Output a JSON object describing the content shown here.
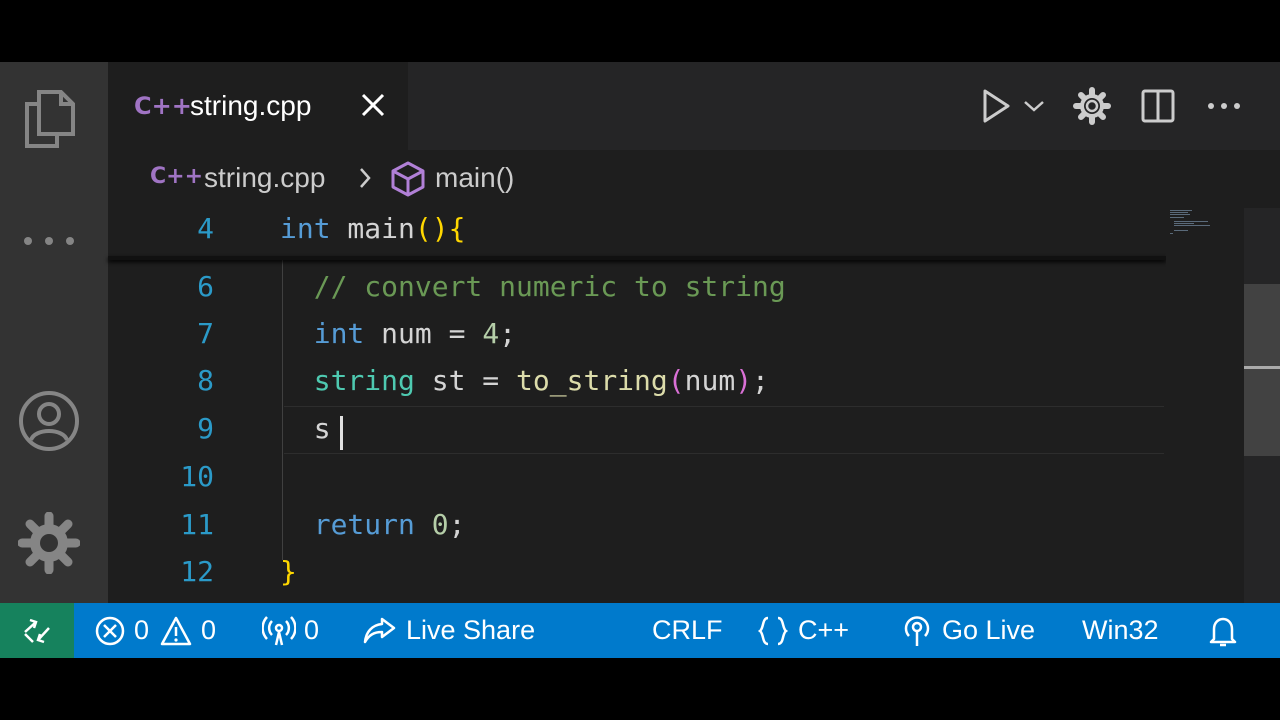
{
  "tab": {
    "lang_badge": "C++",
    "filename": "string.cpp"
  },
  "breadcrumb": {
    "lang_badge": "C++",
    "file": "string.cpp",
    "symbol": "main()"
  },
  "editor": {
    "sticky_line": {
      "number": "4",
      "tokens": [
        [
          "int",
          "kw"
        ],
        [
          " main",
          ""
        ],
        [
          "()",
          "br1"
        ],
        [
          "{",
          "br1"
        ]
      ]
    },
    "lines": [
      {
        "number": "6",
        "tokens": [
          [
            "  // convert numeric to string",
            "cm"
          ]
        ]
      },
      {
        "number": "7",
        "tokens": [
          [
            "  ",
            ""
          ],
          [
            "int",
            "kw"
          ],
          [
            " num = ",
            ""
          ],
          [
            "4",
            "nm"
          ],
          [
            ";",
            ""
          ]
        ]
      },
      {
        "number": "8",
        "tokens": [
          [
            "  ",
            ""
          ],
          [
            "string",
            "ty"
          ],
          [
            " st = ",
            ""
          ],
          [
            "to_string",
            "fn"
          ],
          [
            "(",
            "br2"
          ],
          [
            "num",
            ""
          ],
          [
            ")",
            "br2"
          ],
          [
            ";",
            ""
          ]
        ]
      },
      {
        "number": "9",
        "tokens": [
          [
            "  s",
            ""
          ]
        ]
      },
      {
        "number": "10",
        "tokens": []
      },
      {
        "number": "11",
        "tokens": [
          [
            "  ",
            ""
          ],
          [
            "return",
            "kw"
          ],
          [
            " ",
            ""
          ],
          [
            "0",
            "nm"
          ],
          [
            ";",
            ""
          ]
        ]
      },
      {
        "number": "12",
        "tokens": [
          [
            "}",
            "br1"
          ]
        ]
      }
    ]
  },
  "statusbar": {
    "errors": "0",
    "warnings": "0",
    "ports": "0",
    "live_share": "Live Share",
    "eol": "CRLF",
    "language": "C++",
    "go_live": "Go Live",
    "platform": "Win32"
  },
  "colors": {
    "status_bg": "#007acc",
    "remote_bg": "#16825d",
    "line_number": "#2b9ac8",
    "lang_badge": "#a074c4"
  }
}
